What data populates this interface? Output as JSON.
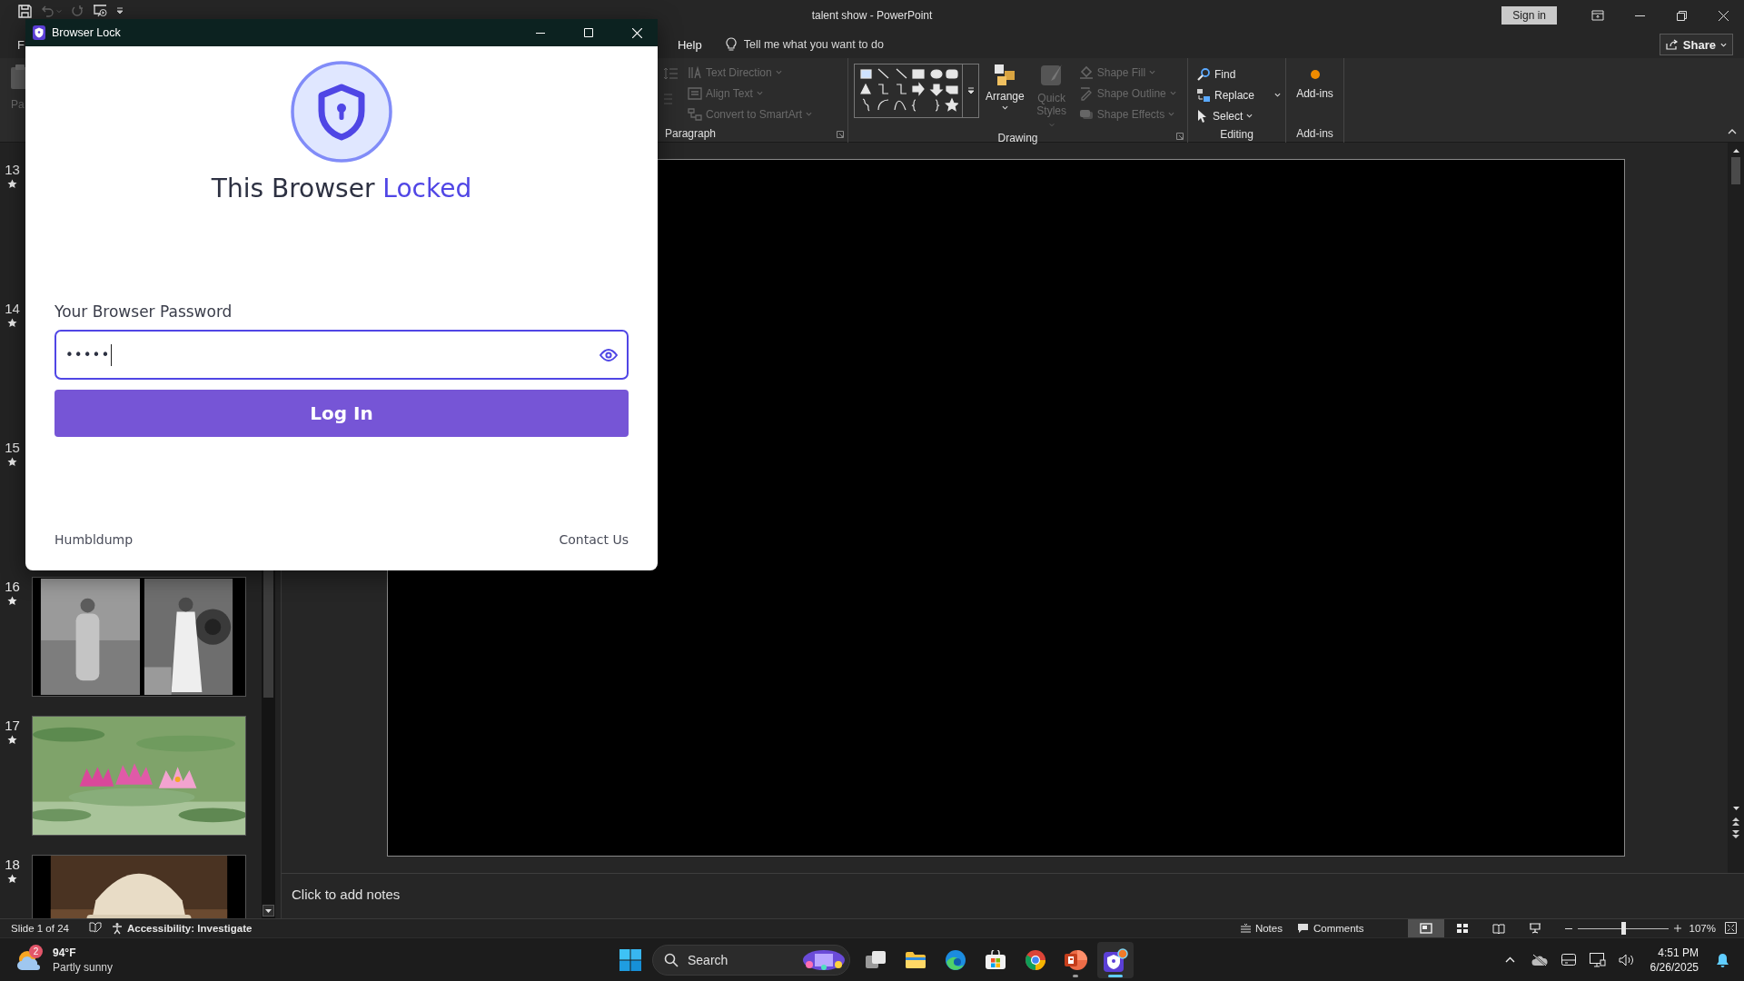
{
  "app_window": {
    "title": "talent show - PowerPoint",
    "sign_in": "Sign in",
    "share": "Share"
  },
  "ribbon_tabs": [
    {
      "label": "F"
    },
    {
      "label": "Help"
    }
  ],
  "tell_me": {
    "placeholder": "Tell me what you want to do"
  },
  "ribbon": {
    "paste_label": "Pa",
    "groups": [
      {
        "label": "Paragraph",
        "commands": [
          {
            "kind": "text-direction",
            "label": "Text Direction",
            "disabled": true
          },
          {
            "kind": "align-text",
            "label": "Align Text",
            "disabled": true
          },
          {
            "kind": "smartart",
            "label": "Convert to SmartArt",
            "disabled": true
          }
        ]
      },
      {
        "label": "Drawing",
        "commands": [
          {
            "kind": "shapes"
          },
          {
            "kind": "arrange",
            "label": "Arrange",
            "disabled": false
          },
          {
            "kind": "quick-styles",
            "label": "Quick Styles",
            "disabled": true
          },
          {
            "kind": "shape-fill",
            "label": "Shape Fill",
            "disabled": true
          },
          {
            "kind": "shape-outline",
            "label": "Shape Outline",
            "disabled": true
          },
          {
            "kind": "shape-effects",
            "label": "Shape Effects",
            "disabled": true
          }
        ]
      },
      {
        "label": "Editing",
        "commands": [
          {
            "kind": "find",
            "label": "Find",
            "disabled": false
          },
          {
            "kind": "replace",
            "label": "Replace",
            "disabled": false
          },
          {
            "kind": "select",
            "label": "Select",
            "disabled": false
          }
        ]
      },
      {
        "label": "Add-ins",
        "commands": [
          {
            "kind": "add-ins",
            "label": "Add-ins",
            "disabled": false
          }
        ]
      }
    ]
  },
  "slides": [
    {
      "number": "13",
      "animated": true
    },
    {
      "number": "14",
      "animated": true
    },
    {
      "number": "15",
      "animated": true
    },
    {
      "number": "16",
      "animated": true,
      "kind": "picture"
    },
    {
      "number": "17",
      "animated": true,
      "kind": "picture"
    },
    {
      "number": "18",
      "animated": true,
      "kind": "picture"
    }
  ],
  "notes": {
    "placeholder": "Click to add notes"
  },
  "status_bar": {
    "slide": "Slide 1 of 24",
    "accessibility": "Accessibility: Investigate",
    "notes": "Notes",
    "comments": "Comments",
    "views": [
      {
        "selected": true
      },
      {
        "selected": false
      },
      {
        "selected": false
      },
      {
        "selected": false
      }
    ],
    "zoom": {
      "level": 0.5,
      "reading": "107%"
    }
  },
  "taskbar": {
    "weather": {
      "badge": "2",
      "temperature": "94°F",
      "condition": "Partly sunny"
    },
    "search": {
      "placeholder": "Search"
    },
    "apps": [
      {
        "kind": "task-view",
        "running": false,
        "selected": false
      },
      {
        "kind": "explorer",
        "running": false,
        "selected": false
      },
      {
        "kind": "edge",
        "running": false,
        "selected": false
      },
      {
        "kind": "store",
        "running": false,
        "selected": false
      },
      {
        "kind": "chrome",
        "running": false,
        "selected": false
      },
      {
        "kind": "powerpoint",
        "running": true,
        "selected": false
      },
      {
        "kind": "lock",
        "running": true,
        "selected": true
      }
    ],
    "time": "4:51 PM",
    "date": "6/26/2025"
  },
  "dialog": {
    "title": "Browser Lock",
    "heading": "This Browser",
    "heading_accent": "Locked",
    "password": {
      "label": "Your Browser Password",
      "value": "•••••",
      "focused": true
    },
    "login": "Log In",
    "footer_left": "Humbldump",
    "footer_right": "Contact Us"
  }
}
